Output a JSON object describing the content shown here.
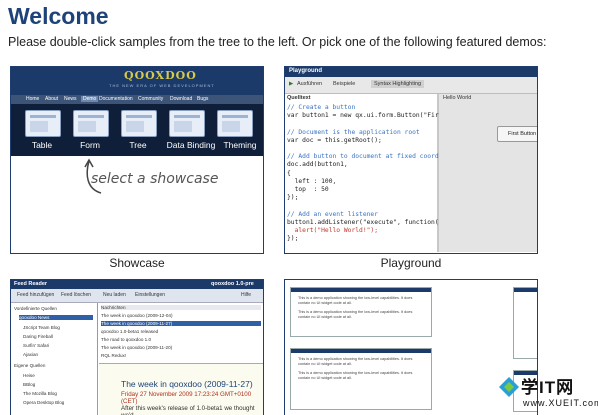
{
  "header": {
    "title": "Welcome",
    "intro": "Please double-click samples from the tree to the left. Or pick one of the following featured demos:"
  },
  "demos": [
    {
      "caption": "Showcase"
    },
    {
      "caption": "Playground"
    },
    {
      "caption": ""
    },
    {
      "caption": ""
    }
  ],
  "showcase": {
    "logo": "QOOXDOO",
    "tagline": "THE NEW ERA OF WEB DEVELOPMENT",
    "nav": [
      "Home",
      "About",
      "News",
      "Demo",
      "Documentation",
      "Community",
      "Download",
      "Bugs"
    ],
    "tiles": [
      "Table",
      "Form",
      "Tree",
      "Data Binding",
      "Theming"
    ],
    "handwriting": "select a showcase"
  },
  "playground": {
    "window_title": "Playground",
    "toolbar": [
      "Ausführen",
      "Beispiele",
      "Syntax Highlighting"
    ],
    "code_label": "Quelltext",
    "code_lines": [
      "// Create a button",
      "var button1 = new qx.ui.form.Button(\"First",
      "",
      "// Document is the application root",
      "var doc = this.getRoot();",
      "",
      "// Add button to document at fixed coordin",
      "doc.add(button1,",
      "{",
      "  left : 100,",
      "  top  : 50",
      "});",
      "",
      "// Add an event listener",
      "button1.addListener(\"execute\", function(e)",
      "  alert(\"Hello World!\");",
      "});"
    ],
    "output_label": "Hello World",
    "button_label": "First Button"
  },
  "feedreader": {
    "title": "Feed Reader",
    "brand": "qooxdoo 1.0-pre",
    "toolbar": [
      "Feed hinzufügen",
      "Feed löschen",
      "Neu laden",
      "Einstellungen",
      "Hilfe"
    ],
    "tree": [
      "Vordefinierte Quellen",
      "qooxdoo News",
      "JScript Team Blog",
      "Daring Fireball",
      "Surfin' Safari",
      "Ajaxian",
      "Eigene Quellen",
      "Heise",
      "BBlog",
      "The Mozilla Blog",
      "Opera Desktop Blog"
    ],
    "list_header": "Nachrichten",
    "list": [
      "The week in qooxdoo (2009-12-04)",
      "The week in qooxdoo (2009-11-27)",
      "qooxdoo 1.0-beta1 released",
      "The road to qooxdoo 1.0",
      "The week in qooxdoo (2009-11-20)",
      "RQL Redux!",
      "The week in qooxdoo (2009-11-13)"
    ],
    "article_title": "The week in qooxdoo (2009-11-27)",
    "article_date": "Friday 27 November 2009 17:23:24 GMT+0100 (CET)",
    "article_body": "After this week's release of 1.0-beta1 we thought we'd"
  },
  "doc_sample": {
    "text": "This is a demo application showing the low-level capabilities. It does contain no UI widget code at all."
  },
  "watermark": {
    "main": "学IT网",
    "sub": "www.XUEIT.com"
  }
}
